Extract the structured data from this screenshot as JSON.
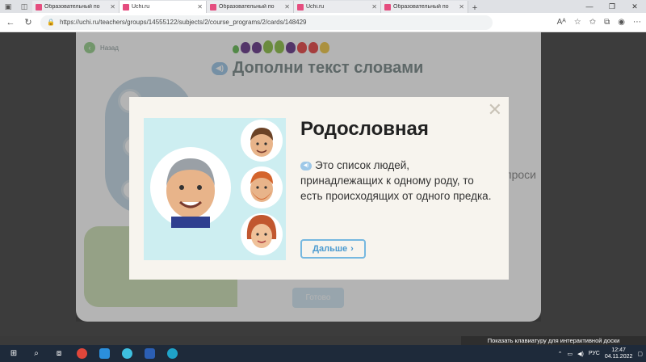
{
  "browser": {
    "tabs": [
      {
        "label": "Образовательный по",
        "fav": "pink",
        "active": false
      },
      {
        "label": "Uchi.ru",
        "fav": "pink",
        "active": true
      },
      {
        "label": "Образовательный по",
        "fav": "pink",
        "active": false
      },
      {
        "label": "Uchi.ru",
        "fav": "pink",
        "active": false
      },
      {
        "label": "Образовательный по",
        "fav": "pink",
        "active": false
      }
    ],
    "url": "https://uchi.ru/teachers/groups/14555122/subjects/2/course_programs/2/cards/148429"
  },
  "page": {
    "back_label": "Назад",
    "heading": "Дополни текст словами",
    "bg_text": "проси",
    "ready_label": "Готово"
  },
  "modal": {
    "title": "Родословная",
    "description": "Это список людей, принадлежащих к одному роду, то есть происходящих от одного предка.",
    "next_label": "Дальше"
  },
  "system": {
    "osk_text": "Показать клавиатуру для интерактивной доски",
    "language": "РУС",
    "time": "12:47",
    "date": "04.11.2022"
  },
  "colors": {
    "accent_blue": "#4a9ad0",
    "back_green": "#9ad28f",
    "heading_gray": "#7b8a8a"
  }
}
